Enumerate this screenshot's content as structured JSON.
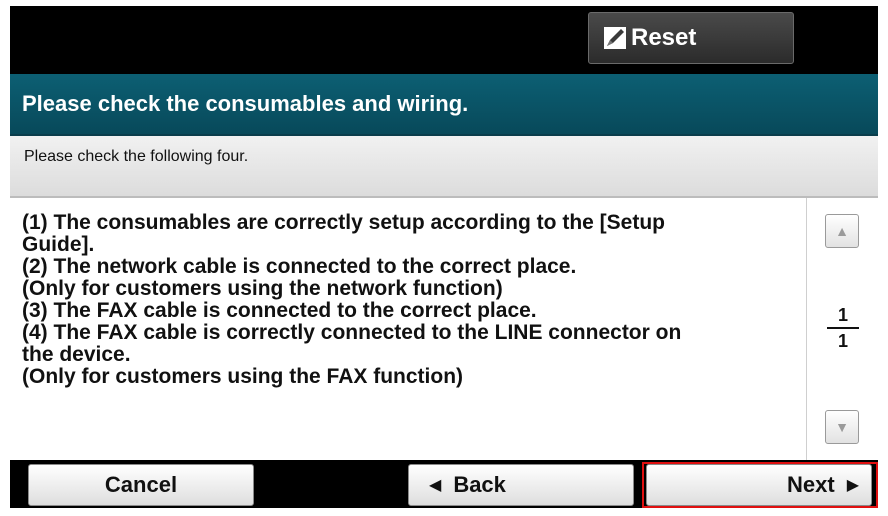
{
  "header": {
    "reset_label": "Reset"
  },
  "title": "Please check the consumables and wiring.",
  "subtitle": "Please check the following four.",
  "content": {
    "lines": [
      "(1) The consumables are correctly setup according to the [Setup",
      "Guide].",
      "(2) The network cable is connected to the correct place.",
      " (Only for customers using the network function)",
      "(3) The FAX cable is connected to the correct place.",
      "(4) The FAX cable is correctly connected to the LINE connector on",
      "the device.",
      " (Only for customers using the FAX function)"
    ]
  },
  "pager": {
    "current": "1",
    "total": "1",
    "up_icon": "triangle-up",
    "down_icon": "triangle-down"
  },
  "footer": {
    "cancel_label": "Cancel",
    "back_label": "Back",
    "next_label": "Next"
  },
  "colors": {
    "title_bar": "#0c5f73",
    "highlight": "#e01010"
  }
}
